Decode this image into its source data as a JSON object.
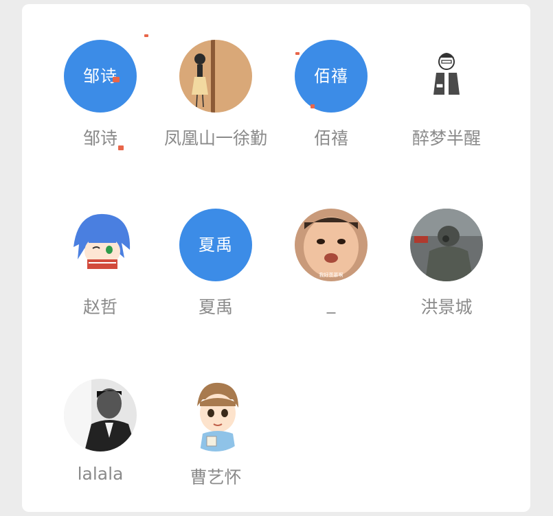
{
  "members": [
    {
      "name": "邹诗",
      "avatar_text": "邹诗",
      "avatar_type": "text"
    },
    {
      "name": "凤凰山一徐勤",
      "avatar_type": "image",
      "icon": "girl-illustration-avatar"
    },
    {
      "name": "佰禧",
      "avatar_text": "佰禧",
      "avatar_type": "text"
    },
    {
      "name": "醉梦半醒",
      "avatar_type": "image",
      "icon": "sketch-man-avatar"
    },
    {
      "name": "赵哲",
      "avatar_type": "image",
      "icon": "anime-blue-hair-avatar"
    },
    {
      "name": "夏禹",
      "avatar_text": "夏禹",
      "avatar_type": "text"
    },
    {
      "name": "_",
      "avatar_type": "image",
      "icon": "baby-photo-avatar",
      "avatar_caption": "我好羡慕啊"
    },
    {
      "name": "洪景城",
      "avatar_type": "image",
      "icon": "soldier-photo-avatar"
    },
    {
      "name": "lalala",
      "avatar_type": "image",
      "icon": "bw-man-photo-avatar"
    },
    {
      "name": "曹艺怀",
      "avatar_type": "image",
      "icon": "cartoon-boy-avatar"
    }
  ],
  "colors": {
    "avatar_blue": "#3c8ce7",
    "name_gray": "#8a8a8a",
    "card_bg": "#ffffff",
    "page_bg": "#ececec"
  }
}
